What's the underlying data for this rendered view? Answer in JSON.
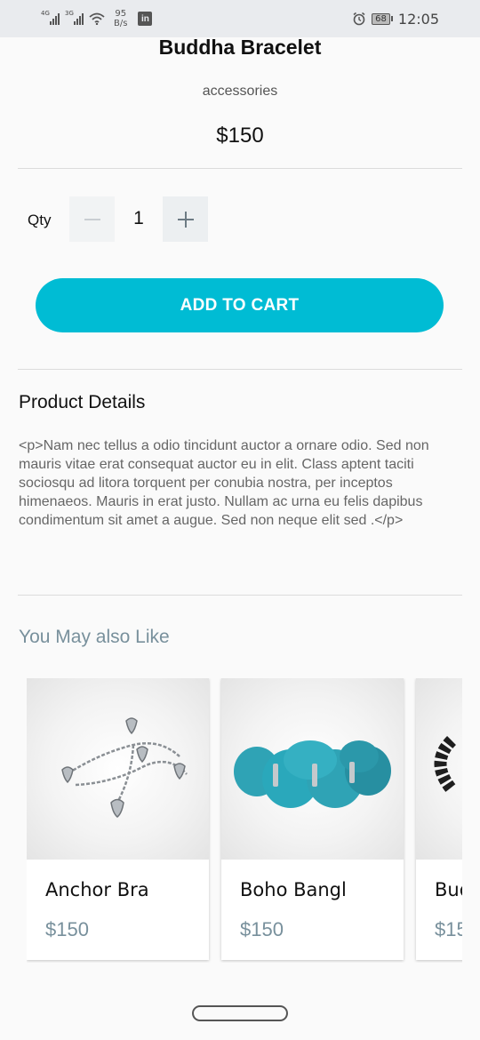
{
  "status_bar": {
    "signal1_tag": "4G",
    "signal2_tag": "3G",
    "net_speed_value": "95",
    "net_speed_unit": "B/s",
    "linkedin_label": "in",
    "battery": "68",
    "time": "12:05"
  },
  "product": {
    "title": "Buddha Bracelet",
    "category": "accessories",
    "price": "$150"
  },
  "quantity": {
    "label": "Qty",
    "value": "1"
  },
  "add_to_cart_label": "ADD TO CART",
  "details": {
    "title": "Product Details",
    "body": "<p>Nam nec tellus a odio tincidunt auctor a ornare odio. Sed non mauris vitae erat consequat auctor eu in elit. Class aptent taciti sociosqu ad litora torquent per conubia nostra, per inceptos himenaeos. Mauris in erat justo. Nullam ac urna eu felis dapibus condimentum sit amet a augue. Sed non neque elit sed .</p>"
  },
  "recommendations": {
    "title": "You May also Like",
    "items": [
      {
        "name": "Anchor Bra",
        "price": "$150"
      },
      {
        "name": "Boho Bangl",
        "price": "$150"
      },
      {
        "name": "Bud",
        "price": "$15"
      }
    ]
  },
  "colors": {
    "accent": "#00bcd4",
    "muted": "#78909c"
  }
}
